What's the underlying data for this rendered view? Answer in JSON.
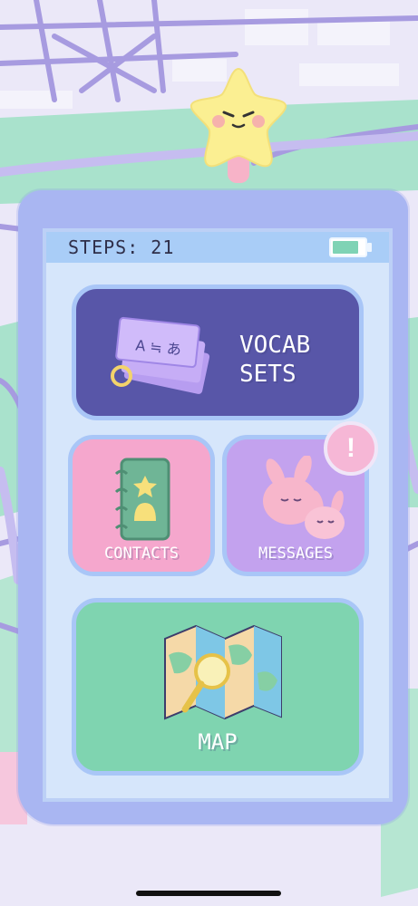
{
  "status_bar": {
    "steps_label": "STEPS: 21",
    "battery_level": 0.85
  },
  "tiles": {
    "vocab": {
      "label_line1": "VOCAB",
      "label_line2": "SETS",
      "card_text": "A ≒ あ"
    },
    "contacts": {
      "label": "CONTACTS"
    },
    "messages": {
      "label": "MESSAGES",
      "badge": "!"
    },
    "map": {
      "label": "MAP"
    }
  },
  "colors": {
    "vocab_tile": "#5856a8",
    "contacts_tile": "#f5a7cd",
    "messages_tile": "#c3a2ee",
    "map_tile": "#7fd4b0",
    "screen": "#d6e6fb",
    "status_bar": "#a9cdf7",
    "mascot": "#fbef92"
  },
  "icons": {
    "mascot": "star-mascot-icon",
    "vocab": "flashcards-icon",
    "contacts": "address-book-icon",
    "messages": "bunnies-icon",
    "map": "folded-map-icon",
    "battery": "battery-icon"
  }
}
